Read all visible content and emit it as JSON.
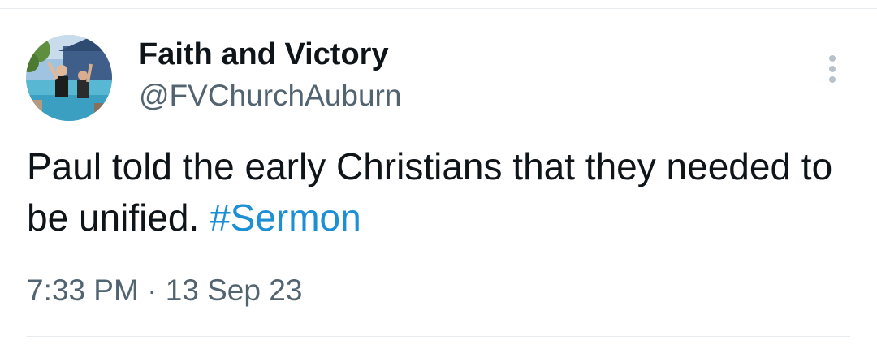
{
  "tweet": {
    "author": {
      "display_name": "Faith and Victory",
      "handle": "@FVChurchAuburn",
      "avatar": "profile-photo"
    },
    "text_before_hashtag": "Paul told the early Christians that they needed to be unified. ",
    "hashtag": "#Sermon",
    "time": "7:33 PM",
    "separator": "·",
    "date": "13 Sep 23",
    "more_icon": "more-vertical-icon"
  },
  "colors": {
    "text": "#0f1419",
    "secondary_text": "#536471",
    "hashtag": "#1d8fd4",
    "divider": "#e7eaec"
  }
}
